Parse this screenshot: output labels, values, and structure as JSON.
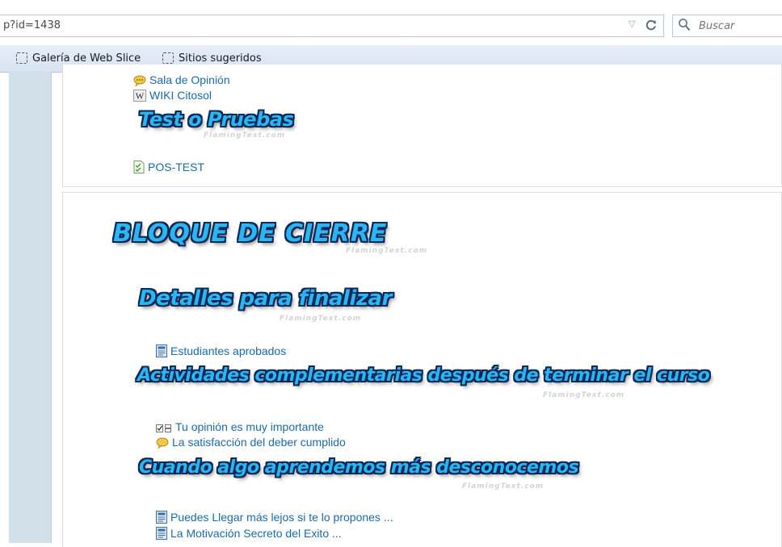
{
  "browser": {
    "url": "p?id=1438",
    "search_placeholder": "Buscar",
    "favorites": [
      {
        "label": "Galería de Web Slice"
      },
      {
        "label": "Sitios sugeridos"
      }
    ]
  },
  "section1": {
    "links_top": [
      {
        "label": "Sala de Opinión",
        "icon": "chat-icon"
      },
      {
        "label": "WIKI Citosol",
        "icon": "wiki-icon"
      }
    ],
    "heading": "Test o Pruebas",
    "links_bottom": [
      {
        "label": "POS-TEST",
        "icon": "quiz-icon"
      }
    ]
  },
  "section2": {
    "title": "BLOQUE DE CIERRE",
    "subsections": [
      {
        "heading": "Detalles para finalizar",
        "links": [
          {
            "label": "Estudiantes aprobados",
            "icon": "document-icon"
          }
        ]
      },
      {
        "heading": "Actividades complementarias después de terminar el curso",
        "links": [
          {
            "label": "Tu opinión es muy importante",
            "icon": "survey-icon"
          },
          {
            "label": "La satisfacción del deber cumplido",
            "icon": "chat-icon"
          }
        ]
      },
      {
        "heading": "Cuando algo aprendemos más desconocemos",
        "links": [
          {
            "label": "Puedes Llegar más lejos si te lo propones ...",
            "icon": "document-icon"
          },
          {
            "label": "La Motivación Secreto del Exito ...",
            "icon": "document-icon"
          }
        ]
      }
    ]
  },
  "watermark": "FlamingText.com",
  "colors": {
    "link": "#1a6aa8",
    "fancy_fill": "#2ab6f2",
    "fancy_outline": "#0b2754",
    "sidebar": "#d2e1e9",
    "favbar": "#dce6f4"
  }
}
